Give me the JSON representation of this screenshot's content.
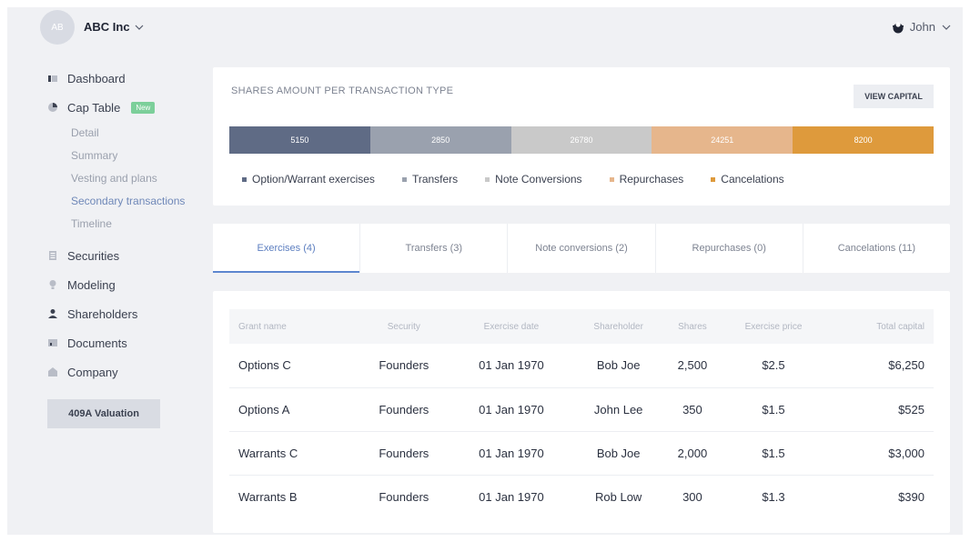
{
  "header": {
    "avatar_initials": "AB",
    "company_name": "ABC Inc",
    "user_name": "John"
  },
  "sidebar": {
    "items": [
      {
        "label": "Dashboard",
        "icon": "dashboard-icon"
      },
      {
        "label": "Cap Table",
        "icon": "pie-chart-icon",
        "badge": "New"
      },
      {
        "label": "Securities",
        "icon": "securities-icon"
      },
      {
        "label": "Modeling",
        "icon": "modeling-icon"
      },
      {
        "label": "Shareholders",
        "icon": "shareholders-icon"
      },
      {
        "label": "Documents",
        "icon": "documents-icon"
      },
      {
        "label": "Company",
        "icon": "company-icon"
      }
    ],
    "cap_table_subitems": [
      {
        "label": "Detail"
      },
      {
        "label": "Summary"
      },
      {
        "label": "Vesting and plans"
      },
      {
        "label": "Secondary transactions",
        "active": true
      },
      {
        "label": "Timeline"
      }
    ],
    "valuation_button": "409A Valuation"
  },
  "shares_card": {
    "title": "SHARES AMOUNT PER TRANSACTION TYPE",
    "view_button": "VIEW CAPITAL",
    "segments": [
      {
        "value": "5150",
        "color": "#5f6b85",
        "weight": 5150
      },
      {
        "value": "2850",
        "color": "#9aa1ae",
        "weight": 2850
      },
      {
        "value": "26780",
        "color": "#c9c9c9",
        "weight": 26780
      },
      {
        "value": "24251",
        "color": "#e6b68c",
        "weight": 24251
      },
      {
        "value": "8200",
        "color": "#de9a3c",
        "weight": 8200
      }
    ],
    "legend": [
      {
        "label": "Option/Warrant exercises",
        "color": "#5f6b85"
      },
      {
        "label": "Transfers",
        "color": "#9aa1ae"
      },
      {
        "label": "Note Conversions",
        "color": "#c9c9c9"
      },
      {
        "label": "Repurchases",
        "color": "#e6b68c"
      },
      {
        "label": "Cancelations",
        "color": "#de9a3c"
      }
    ]
  },
  "tabs": [
    {
      "label": "Exercises (4)",
      "active": true
    },
    {
      "label": "Transfers (3)"
    },
    {
      "label": "Note conversions (2)"
    },
    {
      "label": "Repurchases (0)"
    },
    {
      "label": "Cancelations (11)"
    }
  ],
  "table": {
    "columns": [
      "Grant name",
      "Security",
      "Exercise date",
      "Shareholder",
      "Shares",
      "Exercise price",
      "Total capital"
    ],
    "rows": [
      [
        "Options C",
        "Founders",
        "01 Jan 1970",
        "Bob Joe",
        "2,500",
        "$2.5",
        "$6,250"
      ],
      [
        "Options A",
        "Founders",
        "01 Jan 1970",
        "John Lee",
        "350",
        "$1.5",
        "$525"
      ],
      [
        "Warrants C",
        "Founders",
        "01 Jan 1970",
        "Bob Joe",
        "2,000",
        "$1.5",
        "$3,000"
      ],
      [
        "Warrants B",
        "Founders",
        "01 Jan 1970",
        "Rob Low",
        "300",
        "$1.3",
        "$390"
      ]
    ]
  }
}
